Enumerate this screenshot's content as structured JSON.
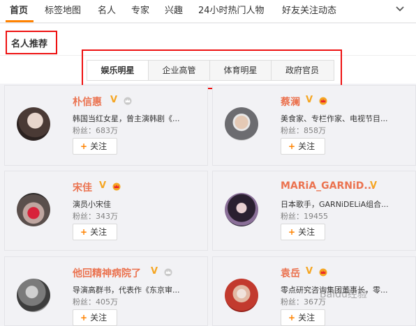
{
  "nav": {
    "items": [
      {
        "label": "首页",
        "active": true
      },
      {
        "label": "标签地图"
      },
      {
        "label": "名人"
      },
      {
        "label": "专家"
      },
      {
        "label": "兴趣"
      },
      {
        "label": "24小时热门人物"
      },
      {
        "label": "好友关注动态"
      }
    ],
    "more_icon": "chevron-down-icon",
    "accent": "#ff8200"
  },
  "section": {
    "title": "名人推荐"
  },
  "tabs": [
    {
      "label": "娱乐明星",
      "active": true
    },
    {
      "label": "企业高管"
    },
    {
      "label": "体育明星"
    },
    {
      "label": "政府官员"
    }
  ],
  "follow_label": "关注",
  "cards": [
    {
      "name": "朴信惠",
      "desc": "韩国当红女星，曾主演韩剧《...",
      "fans": "粉丝：683万",
      "badges": [
        "V",
        "crown-gray"
      ]
    },
    {
      "name": "蔡澜",
      "desc": "美食家、专栏作家、电视节目...",
      "fans": "粉丝：858万",
      "badges": [
        "V",
        "crown-gold"
      ]
    },
    {
      "name": "宋佳",
      "desc": "演员小宋佳",
      "fans": "粉丝：343万",
      "badges": [
        "V",
        "crown-gold"
      ]
    },
    {
      "name": "MARiA_GARNiD...",
      "desc": "日本歌手，GARNiDELiA组合...",
      "fans": "粉丝：19455",
      "badges": [
        "V"
      ]
    },
    {
      "name": "他回精神病院了",
      "desc": "导演高群书，代表作《东京审...",
      "fans": "粉丝：405万",
      "badges": [
        "V",
        "crown-gray"
      ]
    },
    {
      "name": "袁岳",
      "desc": "零点研究咨询集团董事长，零...",
      "fans": "粉丝：367万",
      "badges": [
        "V",
        "crown-gold"
      ]
    }
  ],
  "watermark": "Baidu经验",
  "colors": {
    "name": "#eb7350",
    "v_badge": "#f5a623",
    "highlight_box": "#e11111"
  }
}
